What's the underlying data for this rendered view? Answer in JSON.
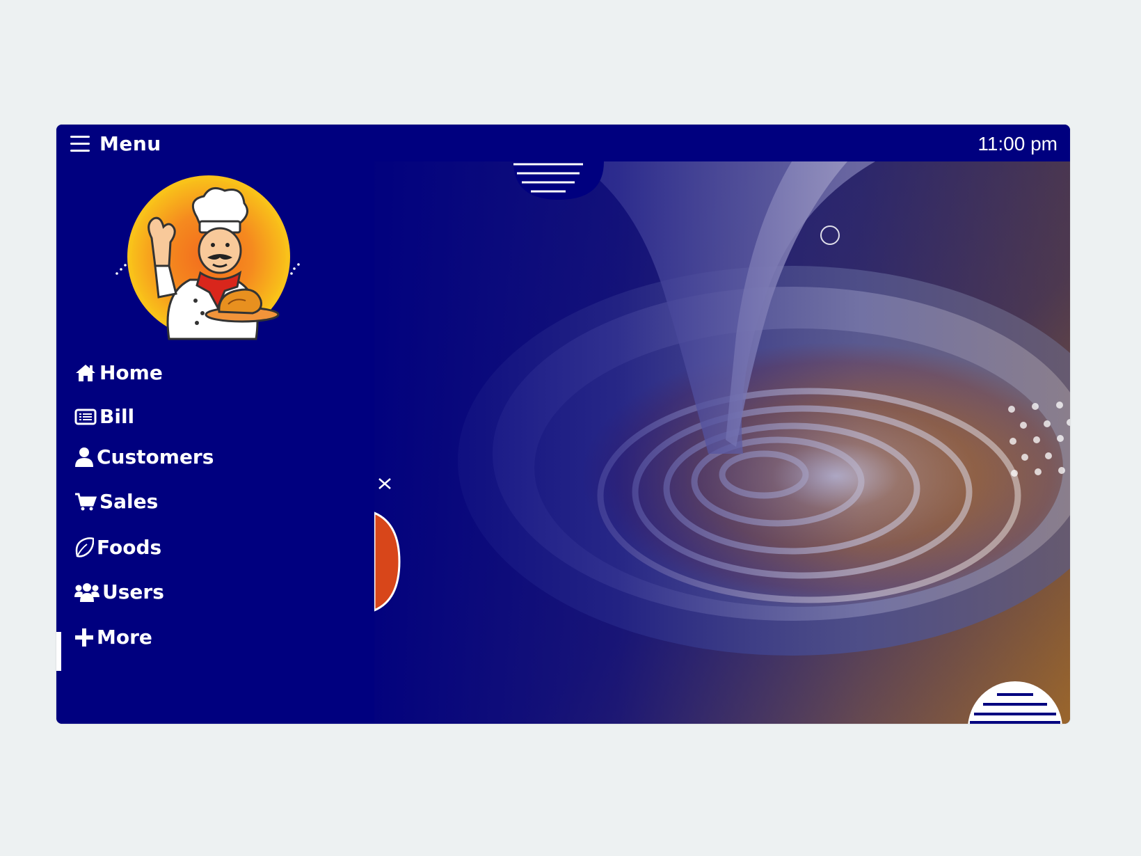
{
  "header": {
    "title": "Menu",
    "time": "11:00 pm"
  },
  "sidebar": {
    "items": [
      {
        "label": "Home",
        "icon": "home-icon"
      },
      {
        "label": "Bill",
        "icon": "bill-icon"
      },
      {
        "label": "Customers",
        "icon": "user-icon"
      },
      {
        "label": "Sales",
        "icon": "cart-icon"
      },
      {
        "label": "Foods",
        "icon": "leaf-icon"
      },
      {
        "label": "Users",
        "icon": "users-icon"
      },
      {
        "label": "More",
        "icon": "plus-icon"
      }
    ],
    "active_index": 6
  },
  "colors": {
    "primary": "#00007f",
    "background": "#edf1f2",
    "accent": "#ffffff",
    "logo_yellow": "#f9b81a",
    "logo_orange": "#f26b1d"
  }
}
